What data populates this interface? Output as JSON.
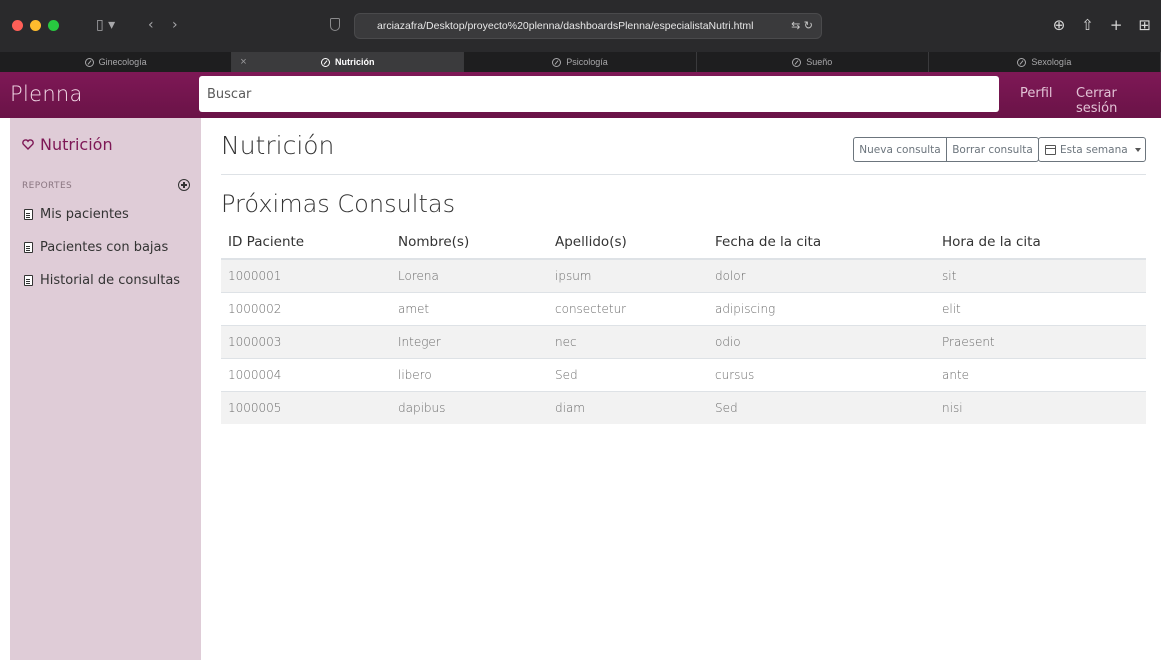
{
  "browser": {
    "url": "arciazafra/Desktop/proyecto%20plenna/dashboardsPlenna/especialistaNutri.html",
    "tabs": [
      {
        "label": "Ginecología",
        "active": false
      },
      {
        "label": "Nutrición",
        "active": true
      },
      {
        "label": "Psicología",
        "active": false
      },
      {
        "label": "Sueño",
        "active": false
      },
      {
        "label": "Sexología",
        "active": false
      }
    ]
  },
  "navbar": {
    "brand": "Plenna",
    "search_placeholder": "Buscar",
    "links": [
      "Perfil",
      "Cerrar sesión"
    ],
    "color": "#7e1856"
  },
  "sidebar": {
    "active_item": "Nutrición",
    "reports_heading": "REPORTES",
    "items": [
      "Mis pacientes",
      "Pacientes con bajas",
      "Historial de consultas"
    ],
    "background": "#dfccd7"
  },
  "main": {
    "title": "Nutrición",
    "buttons": {
      "new": "Nueva consulta",
      "delete": "Borrar consulta",
      "period": "Esta semana"
    },
    "section_title": "Próximas Consultas",
    "table": {
      "headers": [
        "ID Paciente",
        "Nombre(s)",
        "Apellido(s)",
        "Fecha de la cita",
        "Hora de la cita"
      ],
      "rows": [
        [
          "1000001",
          "Lorena",
          "ipsum",
          "dolor",
          "sit"
        ],
        [
          "1000002",
          "amet",
          "consectetur",
          "adipiscing",
          "elit"
        ],
        [
          "1000003",
          "Integer",
          "nec",
          "odio",
          "Praesent"
        ],
        [
          "1000004",
          "libero",
          "Sed",
          "cursus",
          "ante"
        ],
        [
          "1000005",
          "dapibus",
          "diam",
          "Sed",
          "nisi"
        ]
      ]
    }
  }
}
